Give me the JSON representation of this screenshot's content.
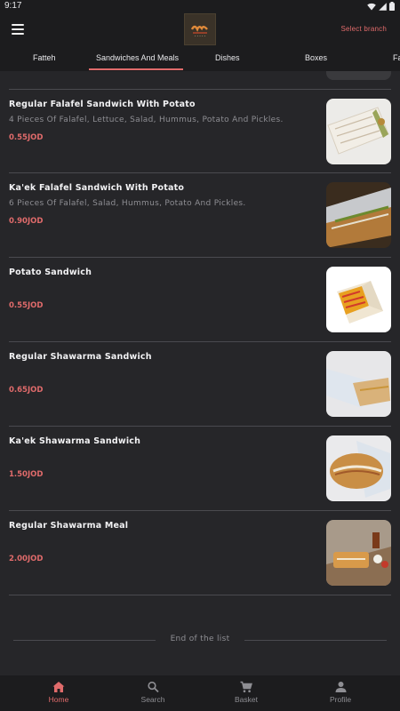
{
  "status_bar": {
    "time": "9:17"
  },
  "header": {
    "select_branch": "Select branch",
    "logo": "restaurant-logo"
  },
  "tabs": [
    {
      "label": "Fatteh",
      "active": false
    },
    {
      "label": "Sandwiches And Meals",
      "active": true
    },
    {
      "label": "Dishes",
      "active": false
    },
    {
      "label": "Boxes",
      "active": false
    },
    {
      "label": "Fa",
      "active": false
    }
  ],
  "items": [
    {
      "name": "Regular Falafel Sandwich With Potato",
      "description": "4 Pieces Of Falafel, Lettuce, Salad, Hummus, Potato And Pickles.",
      "price": "0.55JOD"
    },
    {
      "name": "Ka'ek Falafel Sandwich With Potato",
      "description": "6 Pieces Of Falafel, Salad, Hummus, Potato And Pickles.",
      "price": "0.90JOD"
    },
    {
      "name": "Potato Sandwich",
      "description": "",
      "price": "0.55JOD"
    },
    {
      "name": "Regular Shawarma Sandwich",
      "description": "",
      "price": "0.65JOD"
    },
    {
      "name": "Ka'ek Shawarma Sandwich",
      "description": "",
      "price": "1.50JOD"
    },
    {
      "name": "Regular Shawarma Meal",
      "description": "",
      "price": "2.00JOD"
    }
  ],
  "end_of_list": "End of the list",
  "bottom_nav": [
    {
      "label": "Home",
      "icon": "home-icon",
      "active": true
    },
    {
      "label": "Search",
      "icon": "search-icon",
      "active": false
    },
    {
      "label": "Basket",
      "icon": "cart-icon",
      "active": false
    },
    {
      "label": "Profile",
      "icon": "person-icon",
      "active": false
    }
  ],
  "colors": {
    "accent": "#e06b6b",
    "background": "#262629",
    "bar": "#1c1c1e"
  }
}
